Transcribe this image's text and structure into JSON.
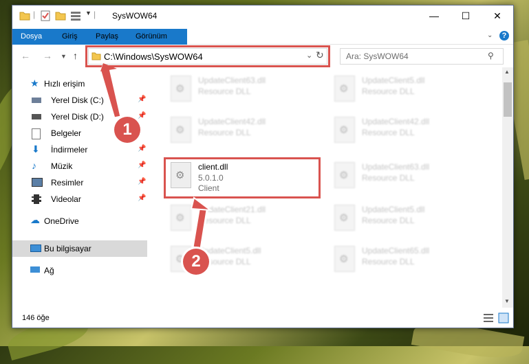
{
  "window": {
    "title": "SysWOW64"
  },
  "ribbon": {
    "tabs": [
      "Dosya",
      "Giriş",
      "Paylaş",
      "Görünüm"
    ]
  },
  "navigation": {
    "address": "C:\\Windows\\SysWOW64",
    "search_placeholder": "Ara: SysWOW64"
  },
  "sidebar": {
    "items": [
      {
        "label": "Hızlı erişim",
        "icon": "star-icon"
      },
      {
        "label": "Yerel Disk (C:)",
        "icon": "drive-icon"
      },
      {
        "label": "Yerel Disk (D:)",
        "icon": "drive-icon"
      },
      {
        "label": "Belgeler",
        "icon": "documents-icon"
      },
      {
        "label": "İndirmeler",
        "icon": "download-icon"
      },
      {
        "label": "Müzik",
        "icon": "music-icon"
      },
      {
        "label": "Resimler",
        "icon": "pictures-icon"
      },
      {
        "label": "Videolar",
        "icon": "video-icon"
      },
      {
        "label": "OneDrive",
        "icon": "cloud-icon"
      },
      {
        "label": "Bu bilgisayar",
        "icon": "computer-icon"
      },
      {
        "label": "Ağ",
        "icon": "network-icon"
      }
    ]
  },
  "files": [
    {
      "name": "UpdateClient63.dll",
      "type": "Resource DLL"
    },
    {
      "name": "UpdateClient5.dll",
      "type": "Resource DLL"
    },
    {
      "name": "UpdateClient42.dll",
      "type": "Resource DLL"
    },
    {
      "name": "UpdateClient42.dll",
      "type": "Resource DLL"
    },
    {
      "name": "client.dll",
      "version": "5.0.1.0",
      "type": "Client"
    },
    {
      "name": "UpdateClient63.dll",
      "type": "Resource DLL"
    },
    {
      "name": "UpdateClient21.dll",
      "type": "Resource DLL"
    },
    {
      "name": "UpdateClient5.dll",
      "type": "Resource DLL"
    },
    {
      "name": "UpdateClient5.dll",
      "type": "Resource DLL"
    },
    {
      "name": "UpdateClient65.dll",
      "type": "Resource DLL"
    }
  ],
  "status": {
    "count": "146 öğe"
  },
  "annotations": {
    "marker1": "1",
    "marker2": "2"
  },
  "colors": {
    "accent": "#1979ca",
    "highlight": "#d9534f"
  }
}
